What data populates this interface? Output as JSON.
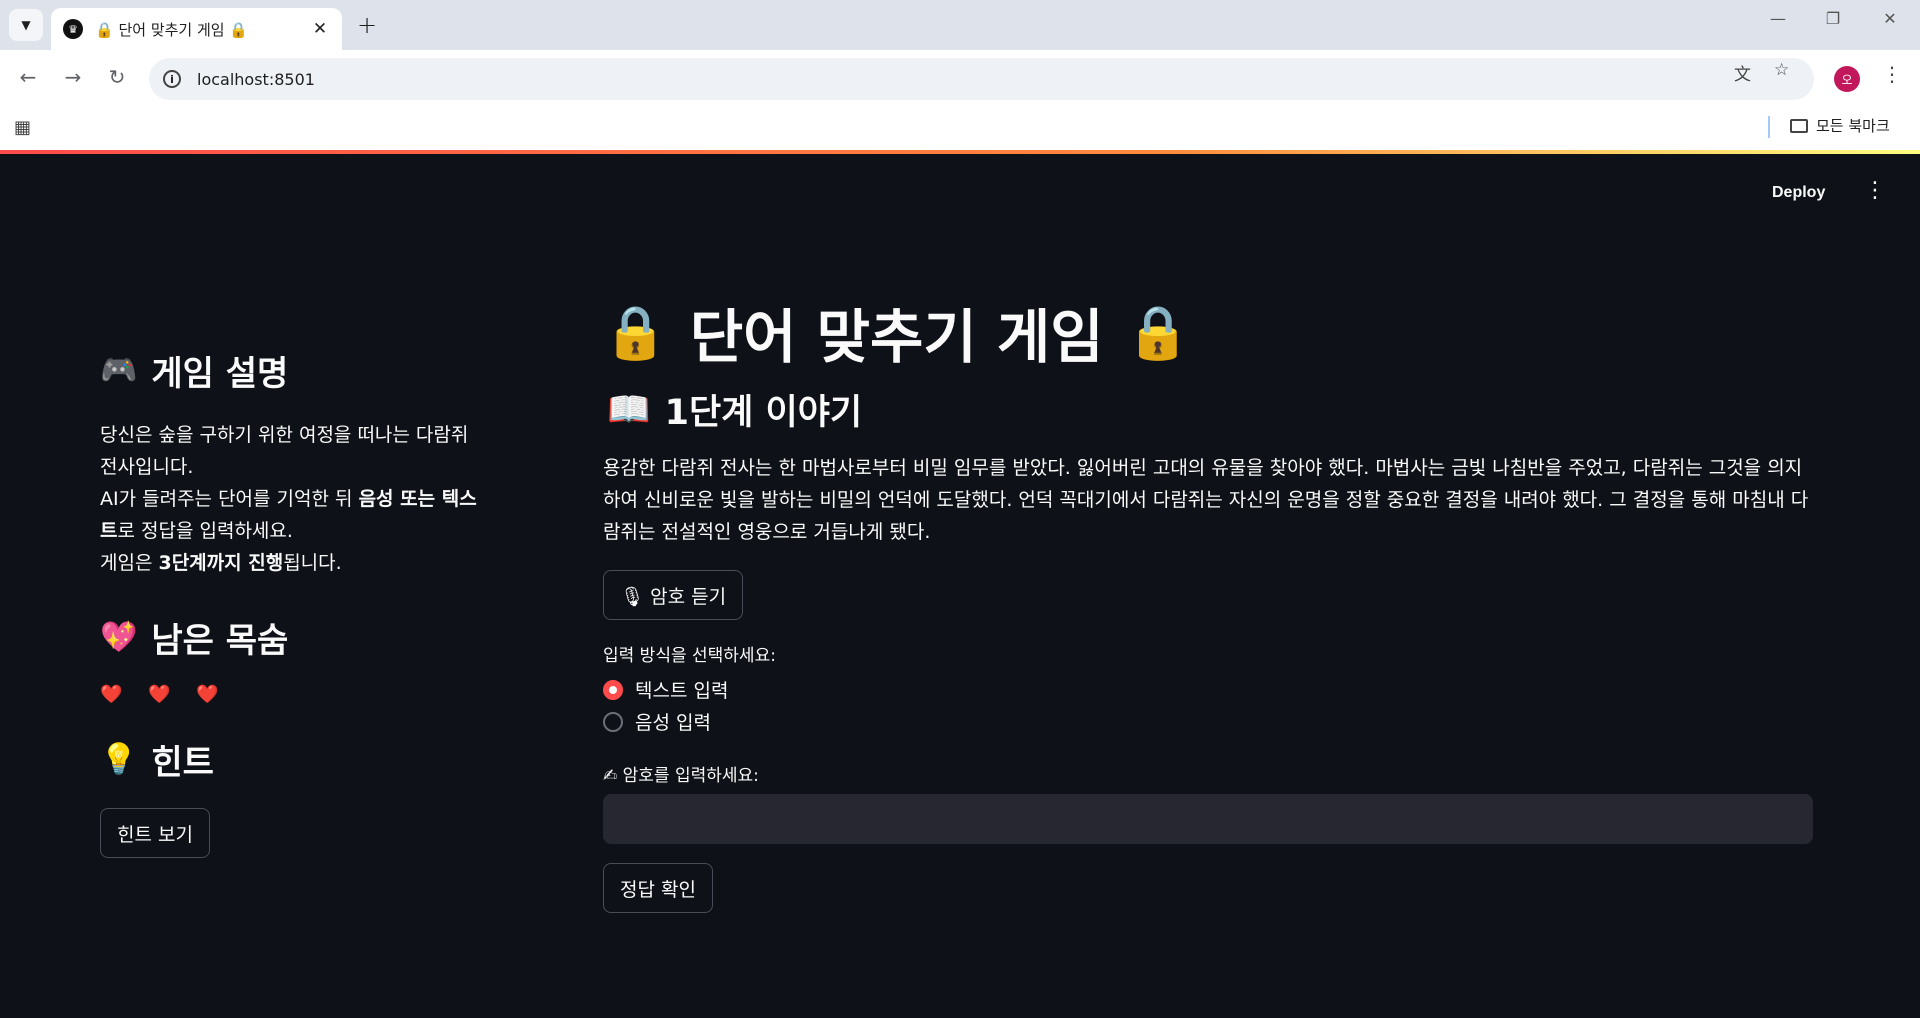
{
  "browser": {
    "tab_title": "🔒 단어 맞추기 게임 🔒",
    "url": "localhost:8501",
    "bookmark_folder": "모든 북마크",
    "profile_initial": "오"
  },
  "app": {
    "deploy_label": "Deploy"
  },
  "sidebar": {
    "rules_title": "게임 설명",
    "rules_line1": "당신은 숲을 구하기 위한 여정을 떠나는 다람쥐 전사입니다.",
    "rules_line2_pre": "AI가 들려주는 단어를 기억한 뒤 ",
    "rules_line2_bold": "음성 또는 텍스트",
    "rules_line2_post": "로 정답을 입력하세요.",
    "rules_line3_pre": "게임은 ",
    "rules_line3_bold": "3단계까지 진행",
    "rules_line3_post": "됩니다.",
    "lives_title": "남은 목숨",
    "lives": "❤️ ❤️ ❤️",
    "hint_title": "힌트",
    "hint_button": "힌트 보기"
  },
  "main": {
    "title": "단어 맞추기 게임",
    "stage_title": "1단계 이야기",
    "story": "용감한 다람쥐 전사는 한 마법사로부터 비밀 임무를 받았다. 잃어버린 고대의 유물을 찾아야 했다. 마법사는 금빛 나침반을 주었고, 다람쥐는 그것을 의지하여 신비로운 빛을 발하는 비밀의 언덕에 도달했다. 언덕 꼭대기에서 다람쥐는 자신의 운명을 정할 중요한 결정을 내려야 했다. 그 결정을 통해 마침내 다람쥐는 전설적인 영웅으로 거듭나게 됐다.",
    "listen_button": "🎙 암호 듣기",
    "input_mode_label": "입력 방식을 선택하세요:",
    "input_modes": [
      "텍스트 입력",
      "음성 입력"
    ],
    "selected_mode": "텍스트 입력",
    "answer_label": "✍ 암호를 입력하세요:",
    "answer_value": "",
    "submit_button": "정답 확인"
  }
}
